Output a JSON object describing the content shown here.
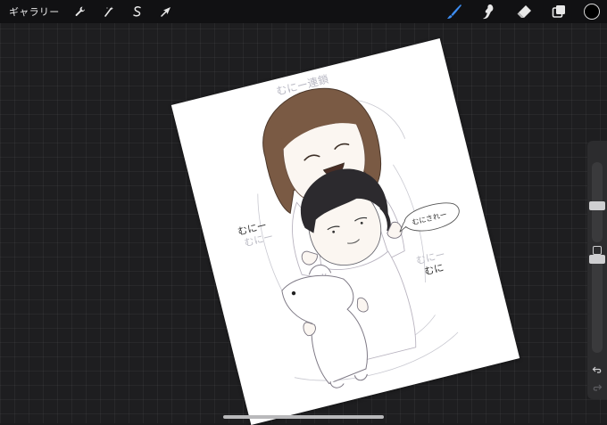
{
  "toolbar": {
    "gallery_label": "ギャラリー",
    "left_tools": [
      {
        "name": "actions",
        "icon": "wrench-icon"
      },
      {
        "name": "adjustments",
        "icon": "magic-wand-icon"
      },
      {
        "name": "selection",
        "icon": "selection-s-icon"
      },
      {
        "name": "transform",
        "icon": "arrow-cursor-icon"
      }
    ],
    "right_tools": [
      {
        "name": "brush",
        "icon": "brush-icon",
        "active": true
      },
      {
        "name": "smudge",
        "icon": "smudge-icon",
        "active": false
      },
      {
        "name": "eraser",
        "icon": "eraser-icon",
        "active": false
      },
      {
        "name": "layers",
        "icon": "layers-icon",
        "active": false
      }
    ],
    "current_color": "#000000",
    "active_color": "#3d8df2"
  },
  "canvas": {
    "title_text": "むにー連鎖",
    "sound_left": "むにー",
    "sound_left_faint": "むにー",
    "speech_bubble": "むにされー",
    "sound_right_faint": "むにー",
    "sound_right": "むに"
  },
  "sidebar": {
    "brush_size_level": 0.55,
    "opacity_level": 0.0
  }
}
